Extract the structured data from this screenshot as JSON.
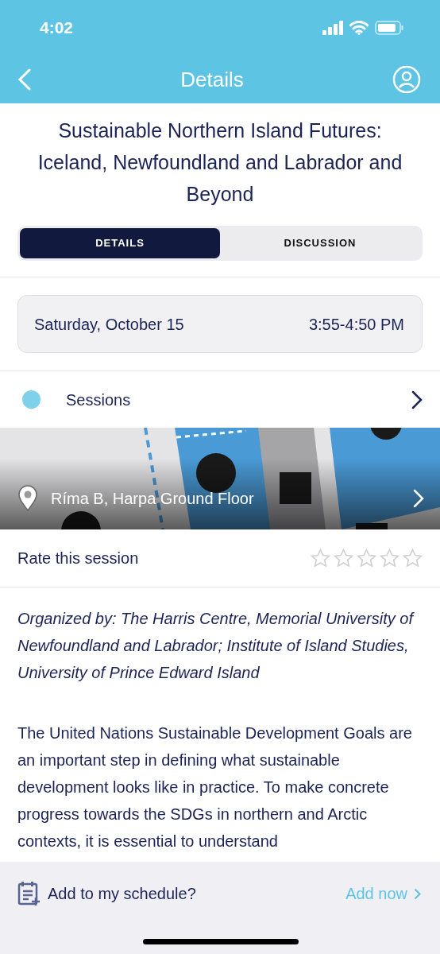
{
  "status_bar": {
    "time": "4:02"
  },
  "nav": {
    "title": "Details"
  },
  "session": {
    "title": "Sustainable Northern Island Futures: Iceland, Newfoundland and Labrador and Beyond"
  },
  "tabs": [
    {
      "label": "DETAILS",
      "selected": true
    },
    {
      "label": "DISCUSSION",
      "selected": false
    }
  ],
  "schedule": {
    "date": "Saturday, October 15",
    "time": "3:55-4:50 PM"
  },
  "track": {
    "label": "Sessions",
    "color": "#7fd0ea"
  },
  "location": {
    "kind": "picture",
    "label": "Ríma B, Harpa Ground Floor"
  },
  "rating": {
    "label": "Rate this session",
    "stars": 0
  },
  "organizer": "Organized by: The Harris Centre, Memorial University of Newfoundland and Labrador; Institute of Island Studies, University of Prince Edward Island",
  "description": "The United Nations Sustainable Development Goals are an important step in defining what sustainable development looks like in practice. To make concrete progress towards the SDGs in northern and Arctic contexts, it is essential to understand",
  "footer": {
    "prompt": "Add to my schedule?",
    "action": "Add now"
  }
}
